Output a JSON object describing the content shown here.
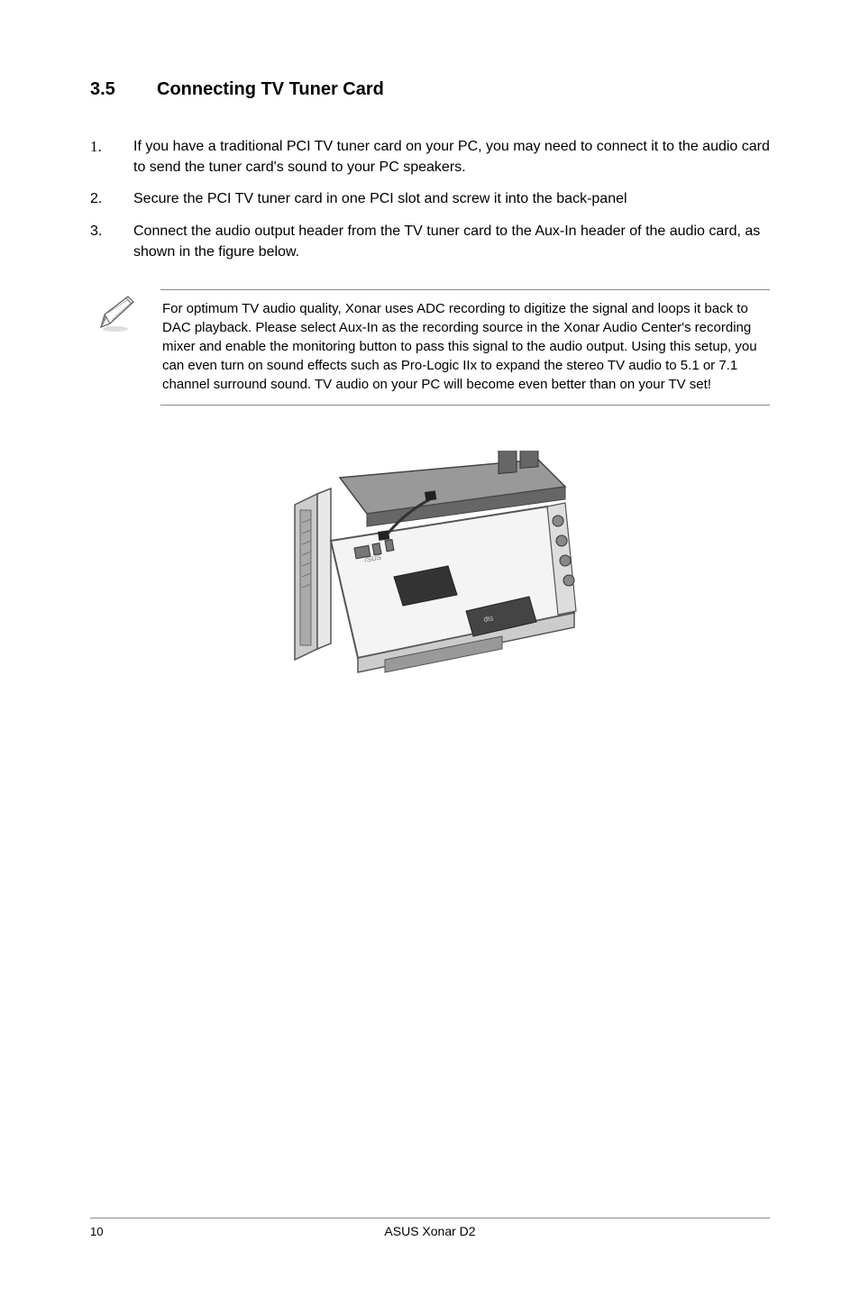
{
  "heading": {
    "number": "3.5",
    "title": "Connecting TV Tuner Card"
  },
  "list": [
    {
      "num": "1.",
      "serif": true,
      "text": "If you have a traditional PCI TV tuner card on your PC, you may need to connect it to the audio card to send the tuner card's sound to your PC speakers."
    },
    {
      "num": "2.",
      "serif": false,
      "text": "Secure the PCI TV tuner card in one PCI slot and screw it into the back-panel"
    },
    {
      "num": "3.",
      "serif": false,
      "text": "Connect the audio output header from the TV tuner card to the Aux-In header of the audio card, as shown in the figure below."
    }
  ],
  "note": {
    "icon_name": "pencil-note-icon",
    "text": "For optimum TV audio quality, Xonar uses ADC recording to digitize the signal and loops it back to DAC playback. Please select Aux-In as the recording source in the Xonar Audio Center's recording mixer and enable the monitoring button to pass this signal to the audio output. Using this setup, you can even turn on sound effects such as Pro-Logic IIx to expand the stereo TV audio to 5.1 or 7.1 channel surround sound. TV audio on your PC will become even better than on your TV set!"
  },
  "footer": {
    "page": "10",
    "product": "ASUS Xonar D2"
  }
}
